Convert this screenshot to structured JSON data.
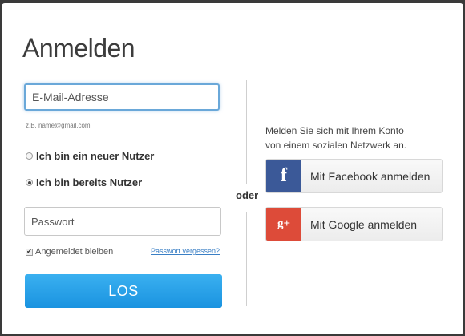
{
  "dialog": {
    "title": "Anmelden",
    "divider_text": "oder"
  },
  "login": {
    "email_placeholder": "E-Mail-Adresse",
    "email_hint": "z.B. name@gmail.com",
    "radio_new": "Ich bin ein neuer Nutzer",
    "radio_existing": "Ich bin bereits Nutzer",
    "selected_radio": "existing",
    "password_placeholder": "Passwort",
    "remember_label": "Angemeldet bleiben",
    "remember_checked": true,
    "forgot_link": "Passwort vergessen?",
    "submit_label": "LOS"
  },
  "social": {
    "prompt_line1": "Melden Sie sich mit Ihrem Konto",
    "prompt_line2": "von einem sozialen Netzwerk an.",
    "facebook_label": "Mit Facebook anmelden",
    "facebook_glyph": "f",
    "google_label": "Mit Google anmelden",
    "google_glyph": "g+"
  },
  "colors": {
    "facebook": "#3b5998",
    "google": "#dd4b39",
    "primary_button": "#1a93e0"
  }
}
